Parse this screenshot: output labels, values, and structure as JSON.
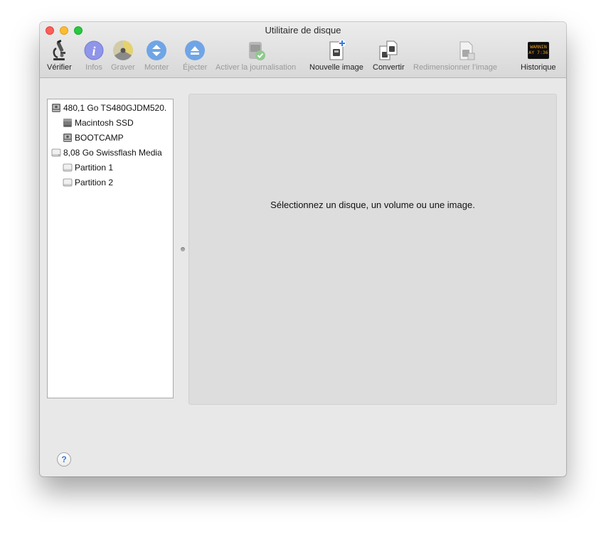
{
  "window": {
    "title": "Utilitaire de disque"
  },
  "toolbar": [
    {
      "label": "Vérifier",
      "icon": "microscope-icon",
      "enabled": true
    },
    {
      "label": "Infos",
      "icon": "info-icon",
      "enabled": false
    },
    {
      "label": "Graver",
      "icon": "burn-icon",
      "enabled": false
    },
    {
      "label": "Monter",
      "icon": "mount-icon",
      "enabled": false
    },
    {
      "label": "Éjecter",
      "icon": "eject-icon",
      "enabled": false
    },
    {
      "label": "Activer la journalisation",
      "icon": "journal-icon",
      "enabled": false
    },
    {
      "label": "Nouvelle image",
      "icon": "new-image-icon",
      "enabled": true
    },
    {
      "label": "Convertir",
      "icon": "convert-icon",
      "enabled": true
    },
    {
      "label": "Redimensionner l’image",
      "icon": "resize-image-icon",
      "enabled": false
    },
    {
      "label": "Historique",
      "icon": "log-icon",
      "enabled": true,
      "display_text": "WARNIN\nAY 7:36"
    }
  ],
  "sidebar": {
    "items": [
      {
        "label": "480,1 Go TS480GJDM520.",
        "icon": "internal-disk-icon"
      },
      {
        "label": "Macintosh SSD",
        "icon": "volume-icon"
      },
      {
        "label": "BOOTCAMP",
        "icon": "internal-disk-icon"
      },
      {
        "label": "8,08 Go Swissflash Media",
        "icon": "external-disk-icon"
      },
      {
        "label": "Partition 1",
        "icon": "external-disk-icon"
      },
      {
        "label": "Partition 2",
        "icon": "external-disk-icon"
      }
    ]
  },
  "main": {
    "message": "Sélectionnez un disque, un volume ou une image."
  },
  "help": {
    "label": "?"
  },
  "colors": {
    "close": "#fc5f57",
    "minimize": "#fdbc2e",
    "maximize": "#28c840",
    "accent": "#2f7ae5"
  }
}
